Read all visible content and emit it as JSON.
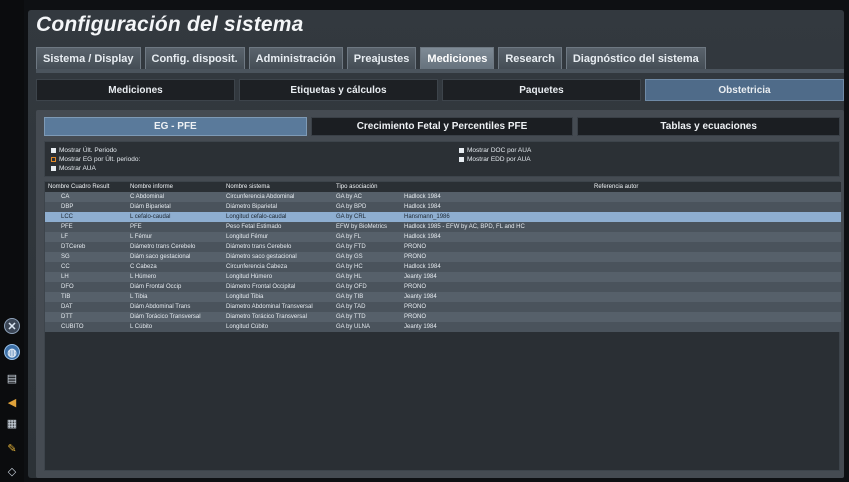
{
  "title": "Configuración del sistema",
  "main_tabs": [
    {
      "label": "Sistema / Display",
      "active": false
    },
    {
      "label": "Config. disposit.",
      "active": false
    },
    {
      "label": "Administración",
      "active": false
    },
    {
      "label": "Preajustes",
      "active": false
    },
    {
      "label": "Mediciones",
      "active": true
    },
    {
      "label": "Research",
      "active": false
    },
    {
      "label": "Diagnóstico del sistema",
      "active": false
    }
  ],
  "sub_tabs": [
    {
      "label": "Mediciones",
      "active": false
    },
    {
      "label": "Etiquetas y cálculos",
      "active": false
    },
    {
      "label": "Paquetes",
      "active": false
    },
    {
      "label": "Obstetricia",
      "active": true
    }
  ],
  "ob_tabs": [
    {
      "label": "EG - PFE",
      "active": true
    },
    {
      "label": "Crecimiento Fetal y Percentiles PFE",
      "active": false
    },
    {
      "label": "Tablas y ecuaciones",
      "active": false
    }
  ],
  "options": {
    "left": [
      {
        "label": "Mostrar Últ. Periodo",
        "state": "checked"
      },
      {
        "label": "Mostrar EG por Últ. periodo:",
        "state": "orange"
      },
      {
        "label": "Mostrar AUA",
        "state": "checked"
      }
    ],
    "right": [
      {
        "label": "Mostrar DOC por AUA",
        "state": "checked"
      },
      {
        "label": "Mostrar EDD por AUA",
        "state": "checked"
      }
    ]
  },
  "table": {
    "headers": [
      "Nombre Cuadro Result",
      "Nombre informe",
      "Nombre sistema",
      "Tipo asociación",
      "",
      "Referencia autor"
    ],
    "rows": [
      [
        "CA",
        "C Abdominal",
        "Circunferencia Abdominal",
        "GA by AC",
        "Hadlock 1984"
      ],
      [
        "DBP",
        "Diám Biparietal",
        "Diámetro Biparietal",
        "GA by BPD",
        "Hadlock 1984"
      ],
      [
        "LCC",
        "L cefalo-caudal",
        "Longitud cefalo-caudal",
        "GA by CRL",
        "Hansmann_1986"
      ],
      [
        "PFE",
        "PFE",
        "Peso Fetal Estimado",
        "EFW by BioMetrics",
        "Hadlock 1985 - EFW by AC, BPD, FL and HC"
      ],
      [
        "LF",
        "L Fémur",
        "Longitud Fémur",
        "GA by FL",
        "Hadlock 1984"
      ],
      [
        "DTCereb",
        "Diámetro trans Cerebelo",
        "Diámetro trans Cerebelo",
        "GA by FTD",
        "PRONO"
      ],
      [
        "SG",
        "Diám saco gestacional",
        "Diámetro saco gestacional",
        "GA by GS",
        "PRONO"
      ],
      [
        "CC",
        "C Cabeza",
        "Circunferencia Cabeza",
        "GA by HC",
        "Hadlock 1984"
      ],
      [
        "LH",
        "L Húmero",
        "Longitud Húmero",
        "GA by HL",
        "Jeanty 1984"
      ],
      [
        "DFO",
        "Diám Frontal Occip",
        "Diámetro Frontal Occipital",
        "GA by OFD",
        "PRONO"
      ],
      [
        "TIB",
        "L Tibia",
        "Longitud Tibia",
        "GA by TIB",
        "Jeanty 1984"
      ],
      [
        "DAT",
        "Diám Abdominal Trans",
        "Diametro Abdominal Transversal",
        "GA by TAD",
        "PRONO"
      ],
      [
        "DTT",
        "Diám Torácico Transversal",
        "Diametro Torácico Transversal",
        "GA by TTD",
        "PRONO"
      ],
      [
        "CUBITO",
        "L Cúbito",
        "Longitud Cúbito",
        "GA by ULNA",
        "Jeanty 1984"
      ]
    ],
    "selected_index": 2
  },
  "rail_icons": [
    "close-circle-icon",
    "globe-icon",
    "printer-icon",
    "speaker-icon",
    "export-icon",
    "brush-icon",
    "wifi-icon"
  ]
}
